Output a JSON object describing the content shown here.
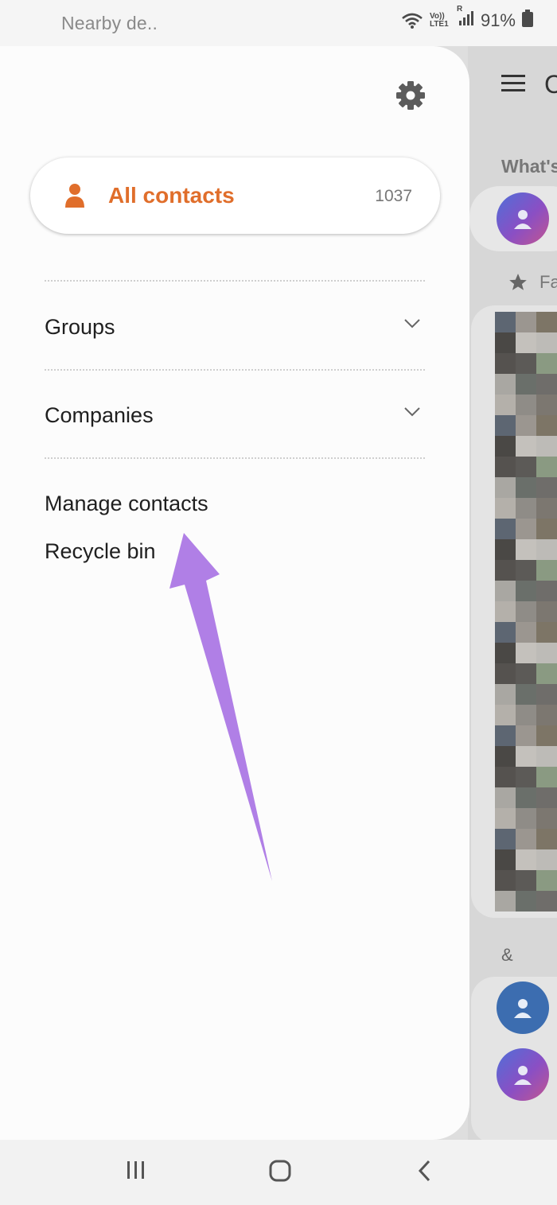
{
  "status_bar": {
    "notification": "Nearby de..",
    "volte_label": "Vo)) LTE1",
    "signal_label": "R",
    "battery": "91%",
    "icons": [
      "wifi-icon",
      "volte-icon",
      "signal-icon",
      "battery-icon"
    ]
  },
  "drawer": {
    "settings_icon": "gear-icon",
    "all_contacts": {
      "label": "All contacts",
      "count": "1037",
      "icon": "person-icon"
    },
    "items": [
      {
        "label": "Groups",
        "expandable": true
      },
      {
        "label": "Companies",
        "expandable": true
      },
      {
        "label": "Manage contacts",
        "expandable": false
      },
      {
        "label": "Recycle bin",
        "expandable": false
      }
    ]
  },
  "background_app": {
    "title_partial": "C",
    "section_partial": "What's",
    "favorites_partial": "Fa",
    "group_header": "&"
  },
  "nav_bar": {
    "buttons": [
      "recents-button",
      "home-button",
      "back-button"
    ]
  },
  "colors": {
    "accent": "#e06e2b",
    "annotation_arrow": "#b07fe6",
    "drawer_bg": "#fcfcfc",
    "scrim": "#d7d7d7"
  }
}
